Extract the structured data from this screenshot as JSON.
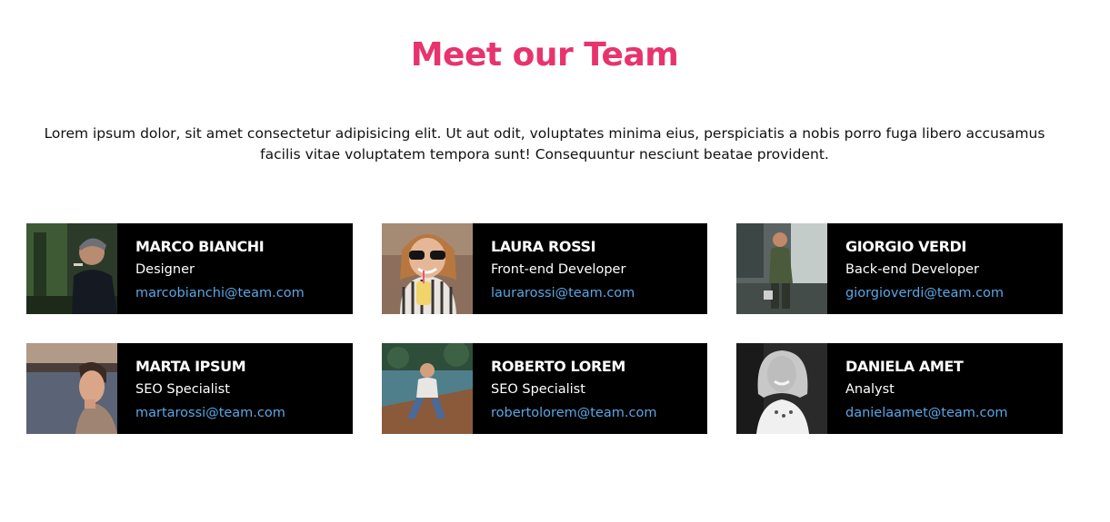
{
  "section": {
    "title": "Meet our Team",
    "intro": "Lorem ipsum dolor, sit amet consectetur adipisicing elit. Ut aut odit, voluptates minima eius, perspiciatis a nobis porro fuga libero accusamus facilis vitae voluptatem tempora sunt! Consequuntur nesciunt beatae provident."
  },
  "colors": {
    "accent": "#e8336d",
    "card_bg": "#000000",
    "link": "#5aa7e6"
  },
  "members": [
    {
      "name": "MARCO BIANCHI",
      "role": "Designer",
      "email": "marcobianchi@team.com"
    },
    {
      "name": "LAURA ROSSI",
      "role": "Front-end Developer",
      "email": "laurarossi@team.com"
    },
    {
      "name": "GIORGIO VERDI",
      "role": "Back-end Developer",
      "email": "giorgioverdi@team.com"
    },
    {
      "name": "MARTA IPSUM",
      "role": "SEO Specialist",
      "email": "martarossi@team.com"
    },
    {
      "name": "ROBERTO LOREM",
      "role": "SEO Specialist",
      "email": "robertolorem@team.com"
    },
    {
      "name": "DANIELA AMET",
      "role": "Analyst",
      "email": "danielaamet@team.com"
    }
  ]
}
